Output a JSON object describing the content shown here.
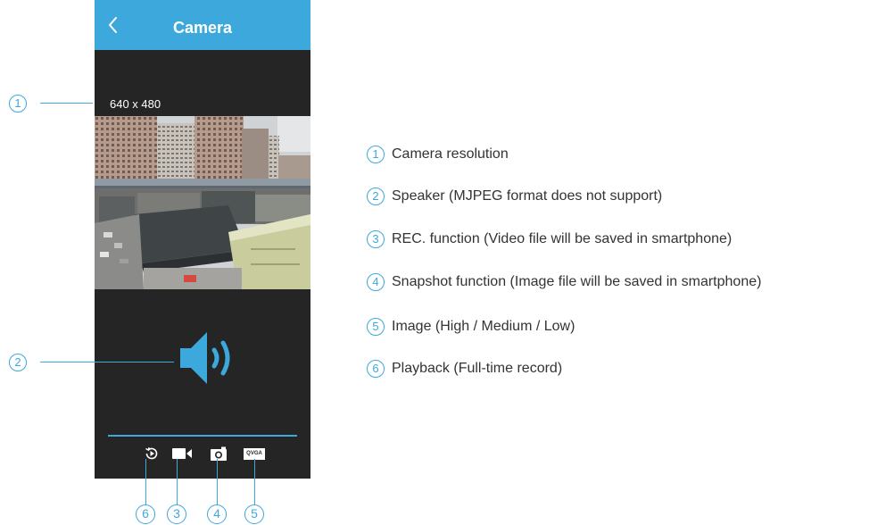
{
  "app": {
    "title": "Camera",
    "resolution": "640 x 480",
    "qvga_label": "QVGA"
  },
  "toolbar": {
    "buttons": [
      {
        "name": "playback",
        "icon": "playback-icon"
      },
      {
        "name": "record",
        "icon": "video-camera-icon"
      },
      {
        "name": "snapshot",
        "icon": "camera-icon"
      },
      {
        "name": "quality",
        "icon": "qvga-badge"
      }
    ]
  },
  "callouts": {
    "resolution": "1",
    "speaker": "2",
    "bottom": [
      "6",
      "3",
      "4",
      "5"
    ]
  },
  "legend": [
    {
      "num": "1",
      "text": "Camera resolution"
    },
    {
      "num": "2",
      "text": "Speaker (MJPEG format does not support)"
    },
    {
      "num": "3",
      "text": "REC. function (Video file will be saved in smartphone)"
    },
    {
      "num": "4",
      "text": "Snapshot function (Image file will be saved in smartphone)"
    },
    {
      "num": "5",
      "text": "Image (High / Medium / Low)"
    },
    {
      "num": "6",
      "text": "Playback (Full-time record)"
    }
  ],
  "colors": {
    "accent": "#3da8dc",
    "screen_bg": "#252525",
    "text": "#333333"
  }
}
